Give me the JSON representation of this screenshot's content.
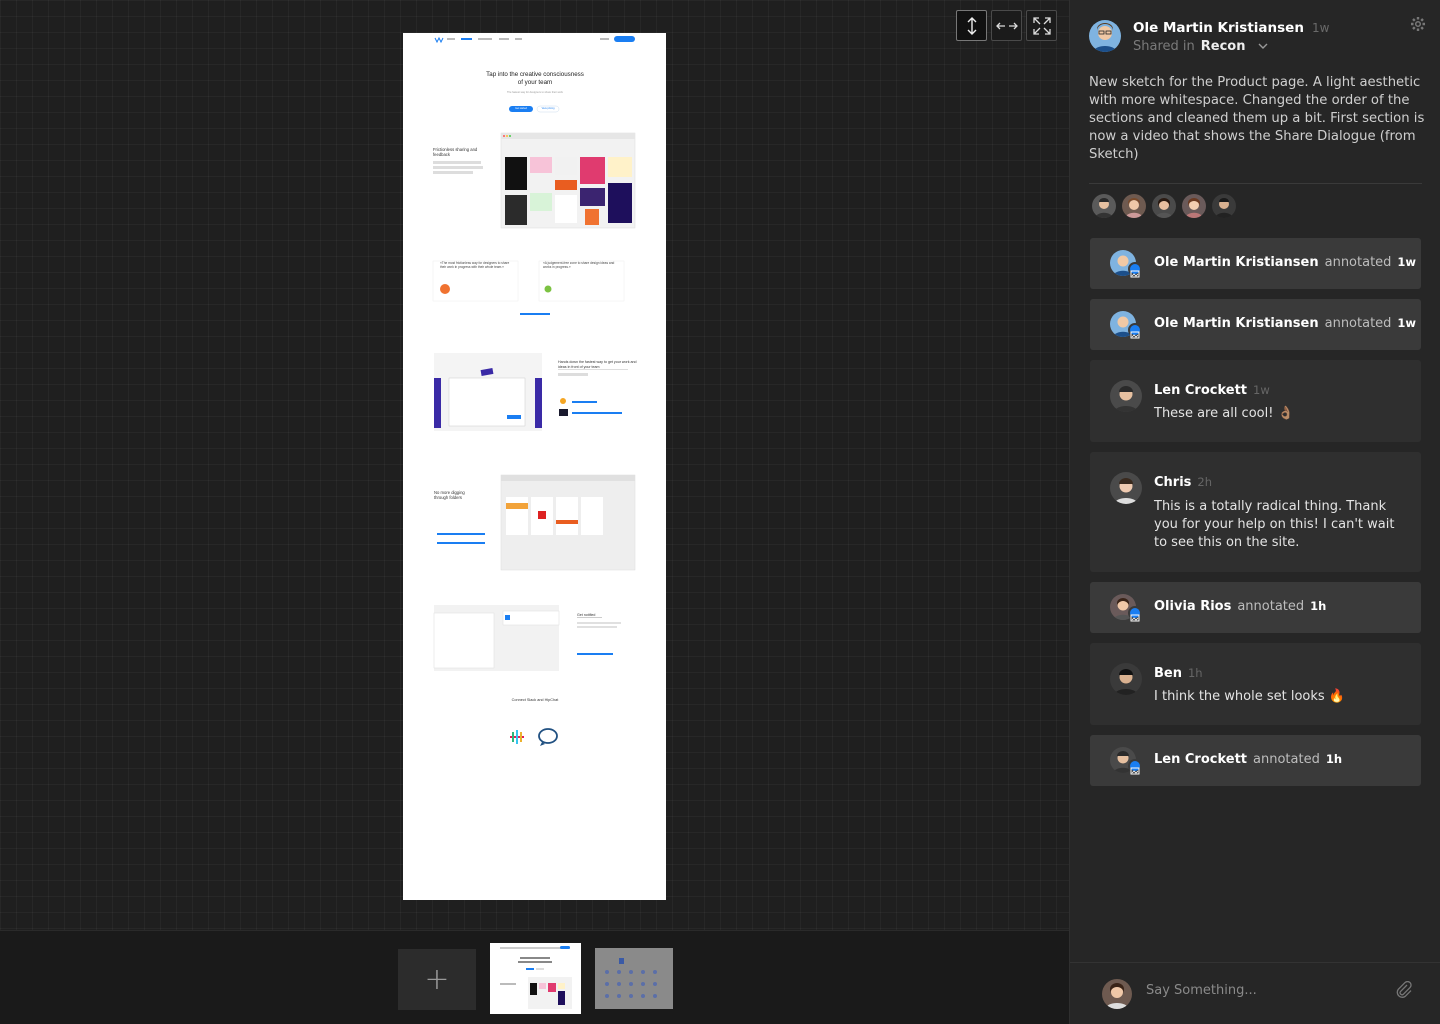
{
  "view_controls": {
    "fit_height_icon": "arrows-vertical-icon",
    "fit_width_icon": "arrows-horizontal-icon",
    "fullscreen_icon": "expand-icon"
  },
  "artboard": {
    "hero_title": "Tap into the creative consciousness of your team",
    "hero_sub": "The fastest way for designers to share their work",
    "hero_primary": "Get started",
    "hero_secondary": "View pricing",
    "s1_title": "Frictionless sharing and feedback",
    "quote1": "«The most frictionless way for designers to share their work in progress with their whole team.»",
    "quote2": "«A judgement-free zone to share design ideas and works in progress.»",
    "read_more": "Read our case studies",
    "s3_title": "Hands down the fastest way to get your work and ideas in front of your team",
    "s4_title": "No more digging through folders",
    "s5_title": "Get notified",
    "s6_title": "Connect Slack and HipChat"
  },
  "filmstrip": {
    "add_label": "+"
  },
  "post": {
    "author": "Ole Martin Kristiansen",
    "time": "1w",
    "shared_in_label": "Shared in",
    "team": "Recon",
    "description": "New sketch for the Product page. A light aesthetic with more whitespace. Changed the order of the sections and cleaned them up a bit. First section is now a video that shows the Share Dialogue (from Sketch)"
  },
  "activity": [
    {
      "type": "annotation",
      "name": "Ole Martin Kristiansen",
      "verb": "annotated",
      "time": "1w"
    },
    {
      "type": "annotation",
      "name": "Ole Martin Kristiansen",
      "verb": "annotated",
      "time": "1w"
    },
    {
      "type": "comment",
      "name": "Len Crockett",
      "time": "1w",
      "text": "These are all cool! 👌🏽"
    },
    {
      "type": "comment",
      "name": "Chris",
      "time": "2h",
      "text": "This is a totally radical thing. Thank you for your help on this! I can't wait to see this on the site."
    },
    {
      "type": "annotation",
      "name": "Olivia Rios",
      "verb": "annotated",
      "time": "1h"
    },
    {
      "type": "comment",
      "name": "Ben",
      "time": "1h",
      "text": "I think the whole set looks 🔥"
    },
    {
      "type": "annotation",
      "name": "Len Crockett",
      "verb": "annotated",
      "time": "1h"
    }
  ],
  "composer": {
    "placeholder": "Say Something..."
  },
  "colors": {
    "accent": "#1a7ef2",
    "sidebar_bg": "#262626",
    "card_bg": "#3a3a3a"
  }
}
